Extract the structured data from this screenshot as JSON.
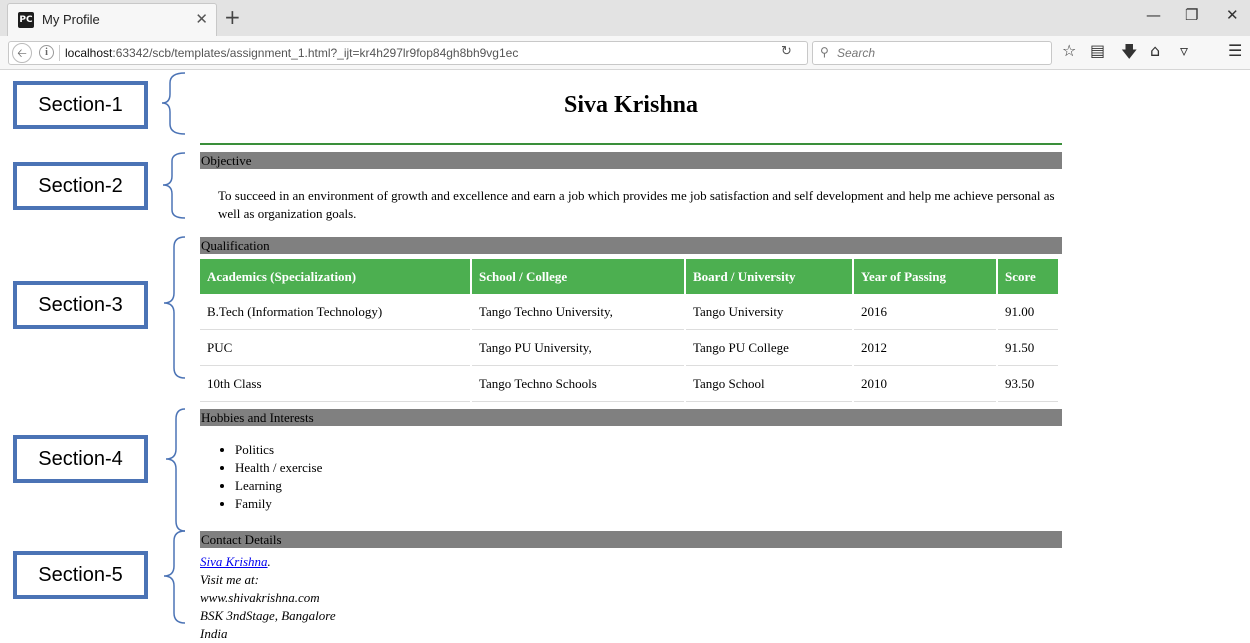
{
  "browser": {
    "tab_title": "My Profile",
    "favicon_label": "PC",
    "url_host": "localhost",
    "url_rest": ":63342/scb/templates/assignment_1.html?_ijt=kr4h297lr9fop84gh8bh9vg1ec",
    "search_placeholder": "Search",
    "new_tab_symbol": "+",
    "close_symbol": "✕",
    "minimize_symbol": "—",
    "restore_symbol": "❐",
    "window_close_symbol": "✕",
    "icons": [
      "back-icon",
      "info-icon",
      "reload-icon",
      "search-icon",
      "bookmark-star-icon",
      "reader-icon",
      "download-icon",
      "home-icon",
      "pocket-icon",
      "menu-icon"
    ]
  },
  "callouts": [
    "Section-1",
    "Section-2",
    "Section-3",
    "Section-4",
    "Section-5"
  ],
  "profile": {
    "name": "Siva Krishna",
    "objective_heading": "Objective",
    "objective_text": "To succeed in an environment of growth and excellence and earn a job which provides me job satisfaction and self development and help me achieve personal as well as organization goals.",
    "qualification_heading": "Qualification",
    "table": {
      "headers": [
        "Academics (Specialization)",
        "School / College",
        "Board / University",
        "Year of Passing",
        "Score"
      ],
      "rows": [
        [
          "B.Tech (Information Technology)",
          "Tango Techno University,",
          "Tango University",
          "2016",
          "91.00"
        ],
        [
          "PUC",
          "Tango PU University,",
          "Tango PU College",
          "2012",
          "91.50"
        ],
        [
          "10th Class",
          "Tango Techno Schools",
          "Tango School",
          "2010",
          "93.50"
        ]
      ]
    },
    "hobbies_heading": "Hobbies and Interests",
    "hobbies": [
      "Politics",
      "Health / exercise",
      "Learning",
      "Family"
    ],
    "contact_heading": "Contact Details",
    "contact": {
      "name_link": "Siva Krishna",
      "after_link": ".",
      "visit": "Visit me at:",
      "website": "www.shivakrishna.com",
      "address": "BSK 3ndStage, Bangalore",
      "country": "India"
    }
  },
  "colors": {
    "section_header_bg": "#808080",
    "table_header_bg": "#4caf50",
    "title_rule": "#3a8f3a",
    "callout_border": "#4b73b5"
  }
}
